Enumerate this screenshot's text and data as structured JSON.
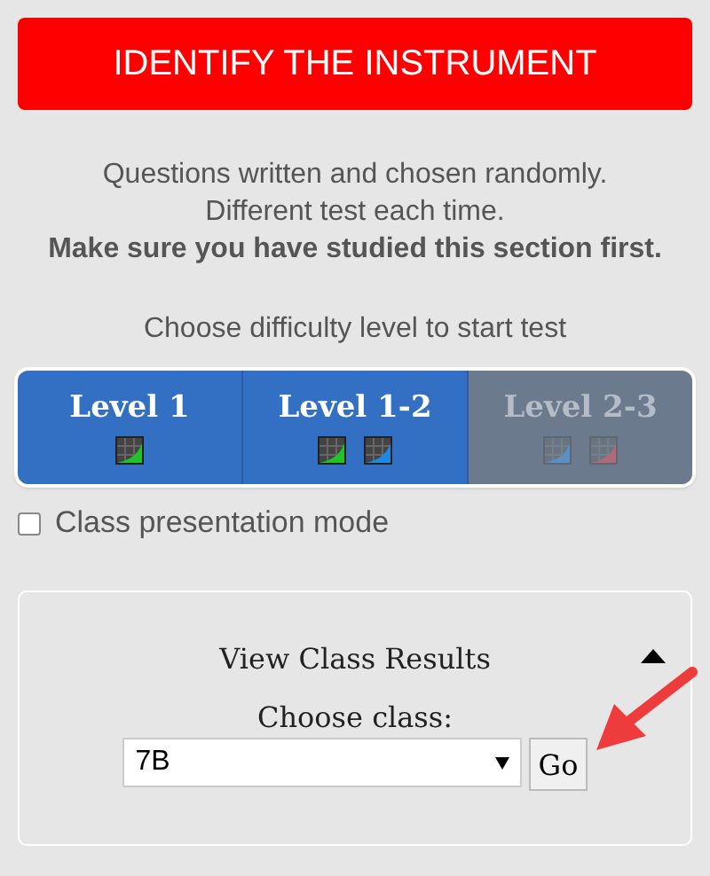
{
  "header_button": {
    "label": "IDENTIFY THE INSTRUMENT"
  },
  "intro": {
    "lines": [
      "Questions written and chosen randomly.",
      "Different test each time."
    ],
    "emphasis": "Make sure you have studied this section first."
  },
  "difficulty_prompt": "Choose difficulty level to start test",
  "levels": [
    {
      "label": "Level 1",
      "disabled": false,
      "icons": [
        {
          "color": "#22c22a"
        }
      ]
    },
    {
      "label": "Level 1-2",
      "disabled": false,
      "icons": [
        {
          "color": "#22c22a"
        },
        {
          "color": "#1e88e5"
        }
      ]
    },
    {
      "label": "Level 2-3",
      "disabled": true,
      "icons": [
        {
          "color": "#5c8fc4"
        },
        {
          "color": "#b06a78"
        }
      ]
    }
  ],
  "presentation_mode": {
    "label": "Class presentation mode",
    "checked": false
  },
  "class_results": {
    "title": "View Class Results",
    "expanded": true,
    "prompt": "Choose class:",
    "class_select": {
      "value": "7B"
    },
    "go_button": "Go"
  }
}
